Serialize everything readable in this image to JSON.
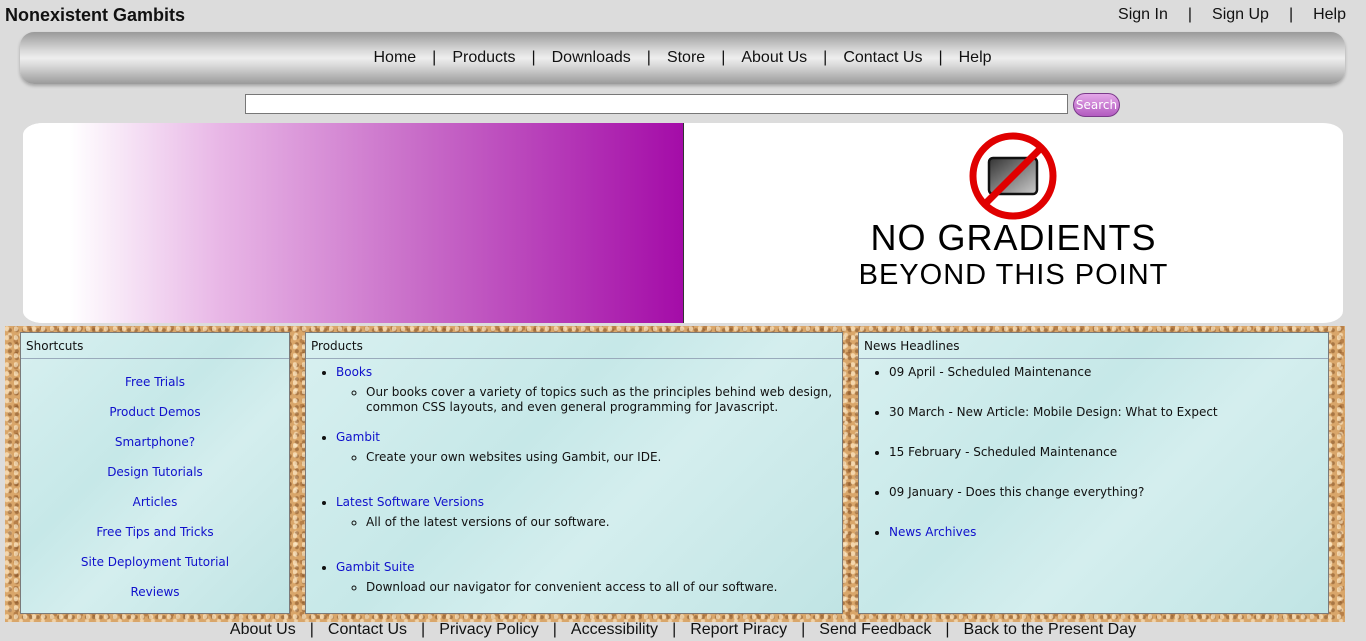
{
  "site": {
    "title": "Nonexistent Gambits"
  },
  "account_links": [
    "Sign In",
    "Sign Up",
    "Help"
  ],
  "nav": [
    "Home",
    "Products",
    "Downloads",
    "Store",
    "About Us",
    "Contact Us",
    "Help"
  ],
  "search": {
    "value": "",
    "placeholder": "",
    "button_label": "Search"
  },
  "banner": {
    "line1": "NO GRADIENTS",
    "line2": "BEYOND THIS POINT",
    "icon": "no-gradient-sign-icon",
    "accent": "#a40ca8"
  },
  "shortcuts": {
    "title": "Shortcuts",
    "items": [
      "Free Trials",
      "Product Demos",
      "Smartphone?",
      "Design Tutorials",
      "Articles",
      "Free Tips and Tricks",
      "Site Deployment Tutorial",
      "Reviews"
    ]
  },
  "products": {
    "title": "Products",
    "items": [
      {
        "name": "Books",
        "desc": "Our books cover a variety of topics such as the principles behind web design, common CSS layouts, and even general programming for Javascript."
      },
      {
        "name": "Gambit",
        "desc": "Create your own websites using Gambit, our IDE."
      },
      {
        "name": "Latest Software Versions",
        "desc": "All of the latest versions of our software."
      },
      {
        "name": "Gambit Suite",
        "desc": "Download our navigator for convenient access to all of our software."
      }
    ]
  },
  "news": {
    "title": "News Headlines",
    "items": [
      "09 April - Scheduled Maintenance",
      "30 March - New Article: Mobile Design: What to Expect",
      "15 February - Scheduled Maintenance",
      "09 January - Does this change everything?"
    ],
    "archive_label": "News Archives"
  },
  "footer": [
    "About Us",
    "Contact Us",
    "Privacy Policy",
    "Accessibility",
    "Report Piracy",
    "Send Feedback",
    "Back to the Present Day"
  ],
  "colors": {
    "link": "#1010cc",
    "panel_bg": "#cdeaea",
    "page_bg": "#dcdcdc"
  }
}
